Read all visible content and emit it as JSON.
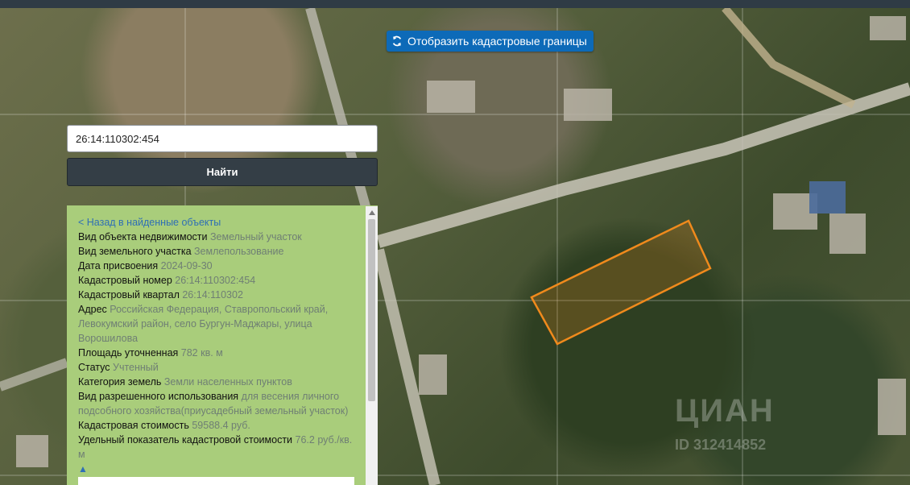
{
  "toolbar": {
    "cadastre_button_label": "Отобразить кадастровые границы",
    "cadastre_icon": "refresh-icon"
  },
  "search": {
    "value": "26:14:110302:454",
    "button_label": "Найти"
  },
  "panel": {
    "back_link": "< Назад в найденные объекты",
    "fields": [
      {
        "key": "Вид объекта недвижимости",
        "value": "Земельный участок"
      },
      {
        "key": "Вид земельного участка",
        "value": "Землепользование"
      },
      {
        "key": "Дата присвоения",
        "value": "2024-09-30"
      },
      {
        "key": "Кадастровый номер",
        "value": "26:14:110302:454"
      },
      {
        "key": "Кадастровый квартал",
        "value": "26:14:110302"
      },
      {
        "key": "Адрес",
        "value": "Российская Федерация, Ставропольский край, Левокумский район, село Бургун-Маджары, улица Ворошилова"
      },
      {
        "key": "Площадь уточненная",
        "value": "782 кв. м"
      },
      {
        "key": "Статус",
        "value": "Учтенный"
      },
      {
        "key": "Категория земель",
        "value": "Земли населенных пунктов"
      },
      {
        "key": "Вид разрешенного использования",
        "value": "для весения личного подсобного хозяйства(приусадебный земельный участок)"
      },
      {
        "key": "Кадастровая стоимость",
        "value": "59588.4 руб."
      },
      {
        "key": "Удельный показатель кадастровой стоимости",
        "value": "76.2 руб./кв. м"
      }
    ],
    "collapse_arrow": "▲"
  },
  "map": {
    "parcel_color": "#f08a1c",
    "watermark": "ЦИАН",
    "watermark_id": "ID 312414852"
  }
}
